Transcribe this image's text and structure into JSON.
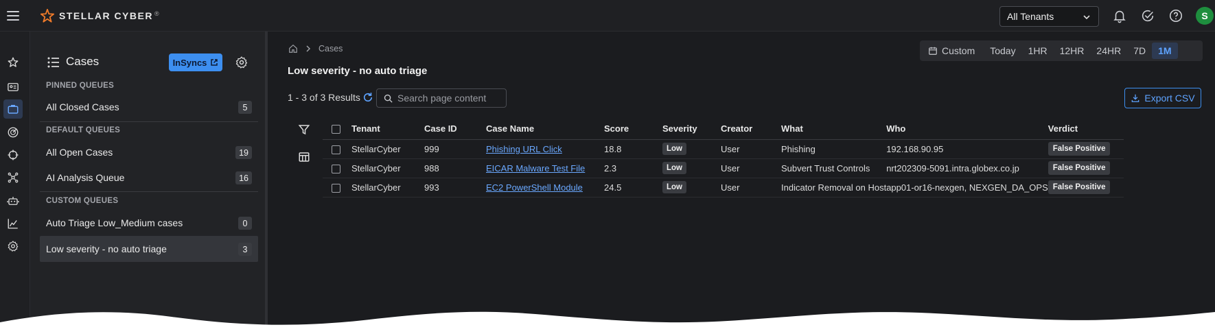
{
  "header": {
    "brand": "STELLAR CYBER",
    "brand_mark": "®",
    "tenant_selected": "All Tenants",
    "avatar_initial": "S",
    "avatar_color": "#1e8e3e"
  },
  "cases_panel": {
    "title": "Cases",
    "insyncs_label": "InSyncs",
    "sections": {
      "pinned": "PINNED QUEUES",
      "default": "DEFAULT QUEUES",
      "custom": "CUSTOM QUEUES"
    },
    "pinned_queues": [
      {
        "label": "All Closed Cases",
        "count": "5"
      }
    ],
    "default_queues": [
      {
        "label": "All Open Cases",
        "count": "19"
      },
      {
        "label": "AI Analysis Queue",
        "count": "16"
      }
    ],
    "custom_queues": [
      {
        "label": "Auto Triage Low_Medium cases",
        "count": "0"
      },
      {
        "label": "Low severity - no auto triage",
        "count": "3"
      }
    ]
  },
  "main": {
    "breadcrumb": "Cases",
    "page_title": "Low severity - no auto triage",
    "time_ranges": [
      "Custom",
      "Today",
      "1HR",
      "12HR",
      "24HR",
      "7D",
      "1M"
    ],
    "time_selected": "1M",
    "results_text": "1 - 3 of 3 Results",
    "search_placeholder": "Search page content",
    "export_label": "Export CSV",
    "columns": [
      "Tenant",
      "Case ID",
      "Case Name",
      "Score",
      "Severity",
      "Creator",
      "What",
      "Who",
      "Verdict"
    ],
    "rows": [
      {
        "tenant": "StellarCyber",
        "case_id": "999",
        "case_name": "Phishing URL Click",
        "score": "18.8",
        "severity": "Low",
        "creator": "User",
        "what": "Phishing",
        "who": "192.168.90.95",
        "verdict": "False Positive"
      },
      {
        "tenant": "StellarCyber",
        "case_id": "988",
        "case_name": "EICAR Malware Test File",
        "score": "2.3",
        "severity": "Low",
        "creator": "User",
        "what": "Subvert Trust Controls",
        "who": "nrt202309-5091.intra.globex.co.jp",
        "verdict": "False Positive"
      },
      {
        "tenant": "StellarCyber",
        "case_id": "993",
        "case_name": "EC2 PowerShell Module",
        "score": "24.5",
        "severity": "Low",
        "creator": "User",
        "what": "Indicator Removal on Host",
        "who": "app01-or16-nexgen, NEXGEN_DA_OPS",
        "verdict": "False Positive"
      }
    ]
  },
  "colors": {
    "accent": "#3d8ff0",
    "link": "#6aa8ff",
    "background": "#1b1c1f"
  }
}
